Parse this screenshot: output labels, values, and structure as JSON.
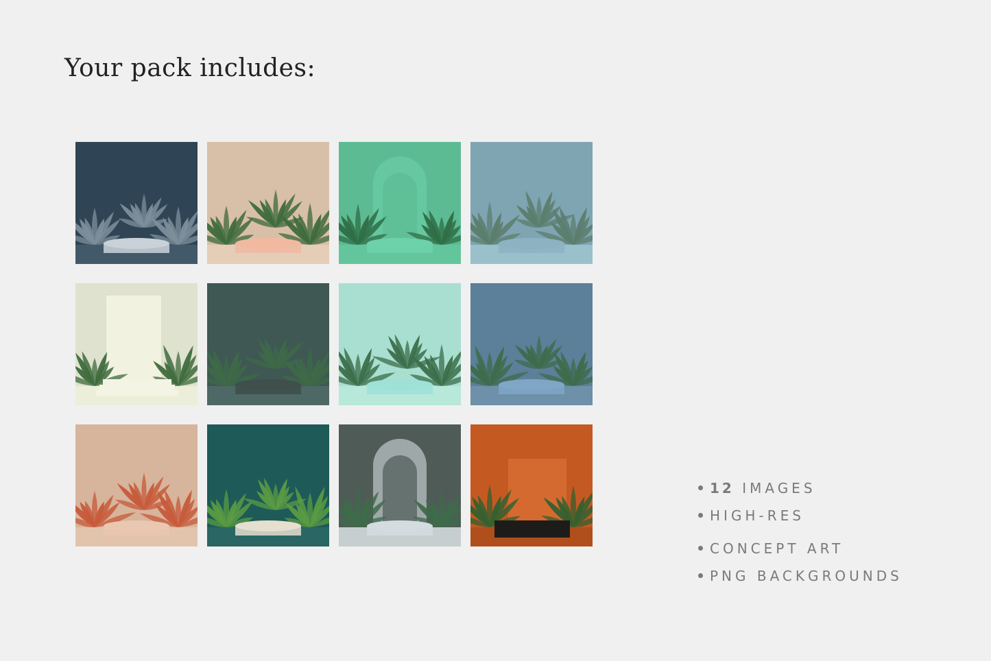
{
  "title": "Your pack includes:",
  "features": {
    "count": "12",
    "count_suffix": "IMAGES",
    "item2": "HIGH-RES",
    "item3": "CONCEPT ART",
    "item4": "PNG BACKGROUNDS"
  },
  "colors": {
    "background": "#f0f0f0",
    "title": "#222222",
    "feature_text": "#7a7a7a"
  },
  "thumbnails": [
    {
      "bg": "#2f4455",
      "floor": "#42596a",
      "pedestal": "#c9d2d8",
      "leaf": "#7e8f9b",
      "style": "plant-pot"
    },
    {
      "bg": "#d8bfa8",
      "floor": "#e5cdb8",
      "pedestal": "#f0b9a0",
      "leaf": "#3e6a3c",
      "style": "plants-pedestal"
    },
    {
      "bg": "#5dbb93",
      "floor": "#63c59c",
      "pedestal": "#6dd1aa",
      "leaf": "#2f6d45",
      "style": "arch"
    },
    {
      "bg": "#7fa4b2",
      "floor": "#9ac0cc",
      "pedestal": "#8db3c2",
      "leaf": "#5b7d6c",
      "style": "plants-pedestal"
    },
    {
      "bg": "#dfe2cf",
      "floor": "#eceed9",
      "pedestal": "#f2f2e0",
      "leaf": "#3f6b3d",
      "style": "wall"
    },
    {
      "bg": "#3f5854",
      "floor": "#4e6865",
      "pedestal": "#3e4f4c",
      "leaf": "#3e6a48",
      "style": "plants-pedestal"
    },
    {
      "bg": "#a9dfd1",
      "floor": "#b7e8da",
      "pedestal": "#9fe0d7",
      "leaf": "#3c6e4a",
      "style": "plants-pedestal"
    },
    {
      "bg": "#5c7f9a",
      "floor": "#6e90a9",
      "pedestal": "#7fa7c5",
      "leaf": "#3e6b4a",
      "style": "plants-pedestal"
    },
    {
      "bg": "#d7b49c",
      "floor": "#e2c4ad",
      "pedestal": "#eac7b1",
      "leaf": "#c75a3a",
      "style": "plants-pedestal"
    },
    {
      "bg": "#1d5a58",
      "floor": "#2a6664",
      "pedestal": "#e4dfcf",
      "leaf": "#5a9b43",
      "style": "plants-pedestal"
    },
    {
      "bg": "#4f5b57",
      "floor": "#c6ced0",
      "pedestal": "#d3dce0",
      "leaf": "#3e6b4a",
      "style": "arch"
    },
    {
      "bg": "#c45a22",
      "floor": "#b04e1c",
      "pedestal": "#1e1c1a",
      "leaf": "#34602f",
      "style": "box"
    }
  ]
}
